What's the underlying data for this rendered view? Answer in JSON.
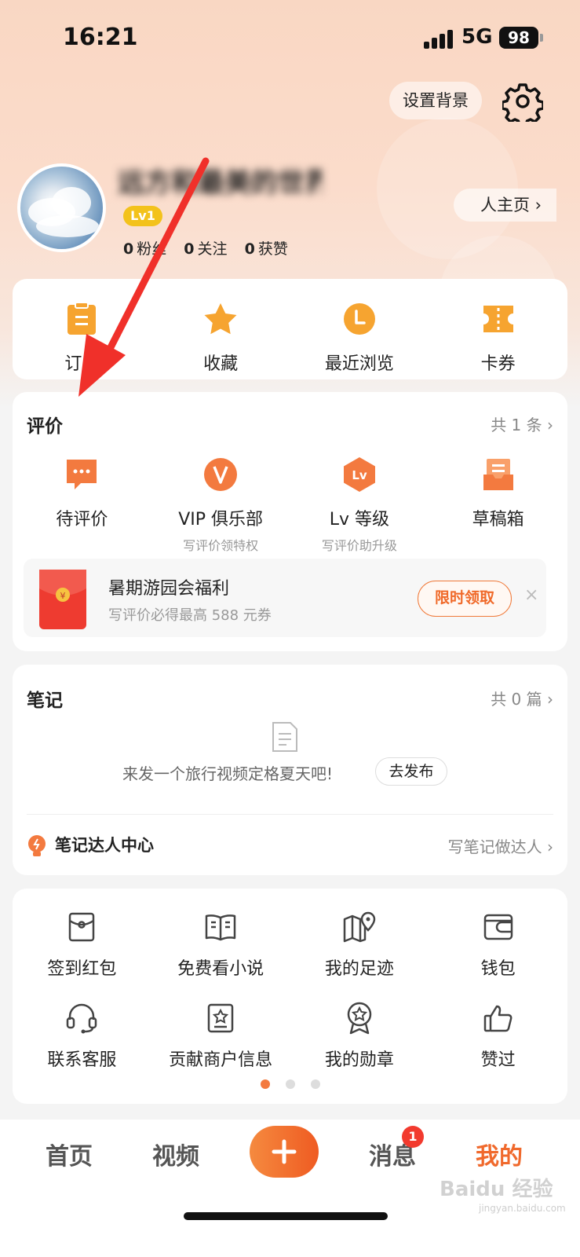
{
  "status_bar": {
    "time": "16:21",
    "network": "5G",
    "battery": "98"
  },
  "header": {
    "set_background": "设置背景"
  },
  "profile": {
    "username": "远方和最美的世界",
    "level": "Lv1",
    "homepage_button": "人主页 ›",
    "stats": [
      {
        "value": "0",
        "label": "粉丝"
      },
      {
        "value": "0",
        "label": "关注"
      },
      {
        "value": "0",
        "label": "获赞"
      }
    ]
  },
  "quick_actions": [
    {
      "label": "订单",
      "icon": "order-icon"
    },
    {
      "label": "收藏",
      "icon": "star-icon"
    },
    {
      "label": "最近浏览",
      "icon": "clock-icon"
    },
    {
      "label": "卡券",
      "icon": "ticket-icon"
    }
  ],
  "reviews": {
    "title": "评价",
    "count_text": "共 1 条 ›",
    "items": [
      {
        "label": "待评价",
        "sub": "",
        "icon": "chat-bubble-icon"
      },
      {
        "label": "VIP 俱乐部",
        "sub": "写评价领特权",
        "icon": "vip-icon"
      },
      {
        "label": "Lv 等级",
        "sub": "写评价助升级",
        "icon": "level-icon"
      },
      {
        "label": "草稿箱",
        "sub": "",
        "icon": "drafts-icon"
      }
    ],
    "promo": {
      "title": "暑期游园会福利",
      "subtitle": "写评价必得最高 588 元券",
      "button": "限时领取",
      "close": "×"
    }
  },
  "notes": {
    "title": "笔记",
    "count_text": "共 0 篇 ›",
    "empty_text": "来发一个旅行视频定格夏天吧!",
    "publish_button": "去发布",
    "talent_title": "笔记达人中心",
    "talent_link": "写笔记做达人 ›"
  },
  "services": [
    {
      "label": "签到红包",
      "icon": "red-packet-icon"
    },
    {
      "label": "免费看小说",
      "icon": "book-icon"
    },
    {
      "label": "我的足迹",
      "icon": "map-pin-icon"
    },
    {
      "label": "钱包",
      "icon": "wallet-icon"
    },
    {
      "label": "联系客服",
      "icon": "headset-icon"
    },
    {
      "label": "贡献商户信息",
      "icon": "shop-info-icon"
    },
    {
      "label": "我的勋章",
      "icon": "medal-icon"
    },
    {
      "label": "赞过",
      "icon": "thumbs-up-icon"
    }
  ],
  "pager": {
    "current": 1,
    "total": 3
  },
  "bottom_nav": {
    "home": "首页",
    "video": "视频",
    "add": "+",
    "messages": "消息",
    "messages_badge": "1",
    "me": "我的"
  },
  "watermark": {
    "main": "Baidu 经验",
    "sub": "jingyan.baidu.com"
  },
  "colors": {
    "accent": "#f0692c",
    "icon_orange": "#f6a430",
    "badge_red": "#f23a2e"
  }
}
